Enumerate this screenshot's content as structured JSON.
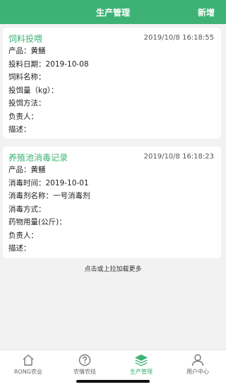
{
  "header": {
    "title": "生产管理",
    "action": "新增"
  },
  "records": [
    {
      "title": "饲料投喂",
      "time": "2019/10/8 16:18:55",
      "rows": [
        {
          "label": "产品：",
          "value": "黄鳝"
        },
        {
          "label": "投料日期：",
          "value": "2019-10-08"
        },
        {
          "label": "饲料名称：",
          "value": ""
        },
        {
          "label": "投饵量（kg）：",
          "value": ""
        },
        {
          "label": "投饵方法：",
          "value": ""
        },
        {
          "label": "负责人：",
          "value": ""
        },
        {
          "label": "描述：",
          "value": ""
        }
      ]
    },
    {
      "title": "养殖池消毒记录",
      "time": "2019/10/8 16:18:23",
      "rows": [
        {
          "label": "产品：",
          "value": "黄鳝"
        },
        {
          "label": "消毒时间：",
          "value": "2019-10-01"
        },
        {
          "label": "消毒剂名称：",
          "value": "一号消毒剂"
        },
        {
          "label": "消毒方式：",
          "value": ""
        },
        {
          "label": "药物用量(公斤)：",
          "value": ""
        },
        {
          "label": "负责人：",
          "value": ""
        },
        {
          "label": "描述：",
          "value": ""
        }
      ]
    }
  ],
  "load_more": "点击或上拉加载更多",
  "tabs": [
    {
      "label": "RONG农业",
      "icon": "home-icon",
      "active": false
    },
    {
      "label": "农情农技",
      "icon": "question-icon",
      "active": false
    },
    {
      "label": "生产管理",
      "icon": "layers-icon",
      "active": true
    },
    {
      "label": "用户中心",
      "icon": "user-icon",
      "active": false
    }
  ],
  "colors": {
    "brand": "#3eb274",
    "background": "#f2f2f2"
  }
}
